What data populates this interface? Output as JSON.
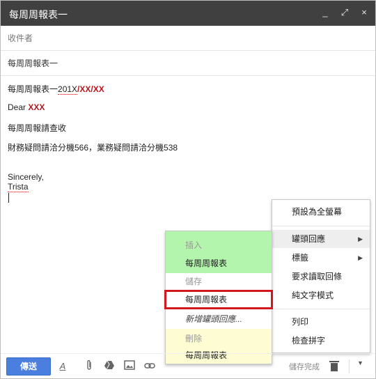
{
  "window": {
    "title": "每周周報表一",
    "controls": {
      "minimize": "_",
      "expand": "⤢",
      "close": "×"
    }
  },
  "compose": {
    "recipients_placeholder": "收件者",
    "subject": "每周周報表一"
  },
  "body": {
    "line1_prefix": "每周周報表一",
    "line1_year": "201X",
    "line1_date": "/XX/XX",
    "line2_prefix": "Dear ",
    "line2_name": "XXX",
    "line3": "每周周報請查收",
    "line4": "財務疑問請洽分機566，業務疑問請洽分機538",
    "signoff": "Sincerely,",
    "signature": "Trista"
  },
  "menu": {
    "items": [
      {
        "label": "預設為全螢幕"
      },
      {
        "label": "罐頭回應",
        "submenu": true
      },
      {
        "label": "標籤",
        "submenu": true
      },
      {
        "label": "要求讀取回條"
      },
      {
        "label": "純文字模式"
      },
      {
        "label": "列印"
      },
      {
        "label": "檢查拼字"
      }
    ]
  },
  "submenu": {
    "insert_header": "插入",
    "insert_item": "每周周報表",
    "save_header": "儲存",
    "save_item": "每周周報表",
    "new_item": "新增罐頭回應...",
    "delete_header": "刪除",
    "delete_item": "每周周報表"
  },
  "toolbar": {
    "send_label": "傳送",
    "saved_status": "儲存完成",
    "icons": [
      "format-text-icon",
      "attach-icon",
      "drive-icon",
      "photo-icon",
      "link-icon",
      "trash-icon",
      "more-options-icon"
    ]
  },
  "colors": {
    "titlebar": "#404040",
    "send_button": "#4a7fe0",
    "insert_highlight": "#b3f5ac",
    "delete_highlight": "#fdfcd2",
    "annotation_box": "#d1181f",
    "placeholder_red": "#c0141c"
  }
}
